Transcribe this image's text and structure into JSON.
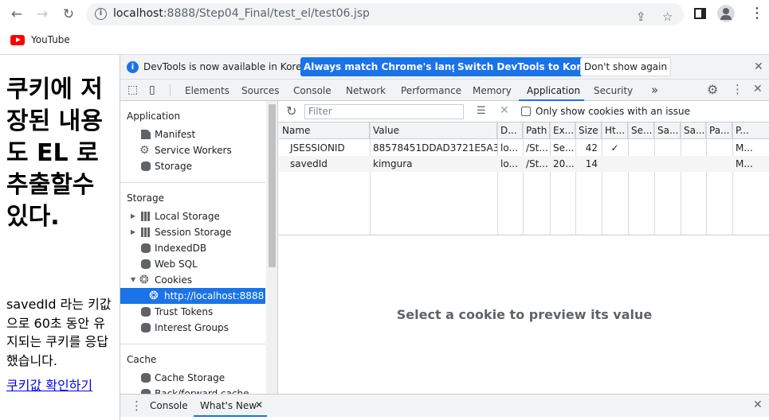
{
  "browser": {
    "url_host": "localhost",
    "url_rest": ":8888/Step04_Final/test_el/test06.jsp",
    "bookmark": "YouTube"
  },
  "page": {
    "heading": "쿠키에 저장된 내용도 EL 로 추출할수 있다.",
    "paragraph": "savedId 라는 키값으로 60초 동안 유지되는 쿠키를 응답했습니다.",
    "link": "쿠키값 확인하기"
  },
  "devtools": {
    "infobar": {
      "text": "DevTools is now available in Korean!",
      "btn_match": "Always match Chrome's language",
      "btn_switch": "Switch DevTools to Korean",
      "btn_dismiss": "Don't show again"
    },
    "tabs": [
      "Elements",
      "Sources",
      "Console",
      "Network",
      "Performance",
      "Memory",
      "Application",
      "Security"
    ],
    "selected_tab": "Application",
    "sidebar": {
      "application_title": "Application",
      "application_items": [
        "Manifest",
        "Service Workers",
        "Storage"
      ],
      "storage_title": "Storage",
      "storage_items": [
        "Local Storage",
        "Session Storage",
        "IndexedDB",
        "Web SQL",
        "Cookies"
      ],
      "cookie_child": "http://localhost:8888",
      "after_items": [
        "Trust Tokens",
        "Interest Groups"
      ],
      "cache_title": "Cache",
      "cache_items": [
        "Cache Storage",
        "Back/forward cache"
      ]
    },
    "toolbar": {
      "filter_placeholder": "Filter",
      "only_issues": "Only show cookies with an issue"
    },
    "table": {
      "headers": [
        "Name",
        "Value",
        "D...",
        "Path",
        "Ex...",
        "Size",
        "Ht...",
        "Se...",
        "Sa...",
        "Sa...",
        "Pa...",
        "P..."
      ],
      "rows": [
        [
          "JSESSIONID",
          "88578451DDAD3721E5A3...",
          "lo...",
          "/St...",
          "Se...",
          "42",
          "✓",
          "",
          "",
          "",
          "",
          "M..."
        ],
        [
          "savedId",
          "kimgura",
          "lo...",
          "/St...",
          "20...",
          "14",
          "",
          "",
          "",
          "",
          "",
          "M..."
        ]
      ]
    },
    "preview_text": "Select a cookie to preview its value",
    "drawer_tabs": [
      "Console",
      "What's New"
    ],
    "accent": "#1a73e8"
  }
}
